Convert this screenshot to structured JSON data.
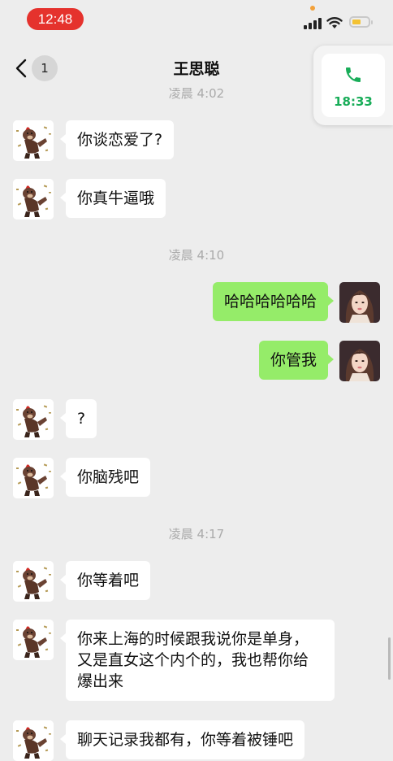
{
  "status_bar": {
    "time": "12:48"
  },
  "header": {
    "title": "王思聪",
    "unread_count": "1"
  },
  "floating_call": {
    "duration": "18:33"
  },
  "timestamps": [
    "凌晨 4:02",
    "凌晨 4:10",
    "凌晨 4:17"
  ],
  "messages": [
    {
      "side": "in",
      "text": "你谈恋爱了?"
    },
    {
      "side": "in",
      "text": "你真牛逼哦"
    },
    {
      "side": "out",
      "text": "哈哈哈哈哈哈"
    },
    {
      "side": "out",
      "text": "你管我"
    },
    {
      "side": "in",
      "text": "?"
    },
    {
      "side": "in",
      "text": "你脑残吧"
    },
    {
      "side": "in",
      "text": "你等着吧"
    },
    {
      "side": "in",
      "text": "你来上海的时候跟我说你是单身，又是直女这个内个的，我也帮你给爆出来"
    },
    {
      "side": "in",
      "text": "聊天记录我都有，你等着被锤吧"
    }
  ],
  "colors": {
    "sent_bubble": "#95ec69",
    "received_bubble": "#ffffff",
    "call_green": "#19ad59",
    "time_pill": "#e5322d"
  }
}
